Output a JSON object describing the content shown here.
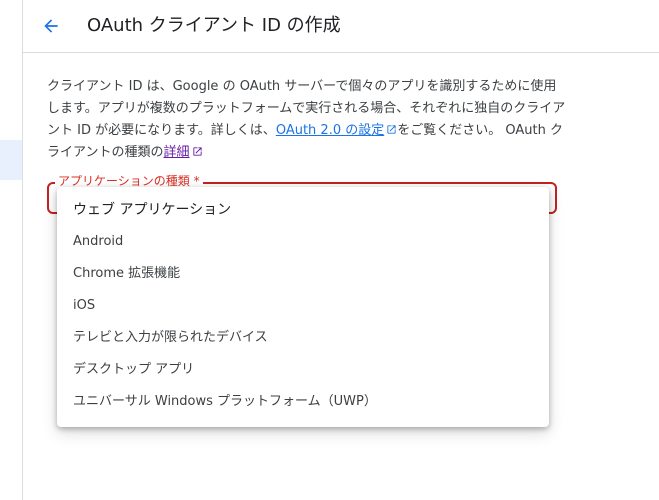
{
  "header": {
    "title": "OAuth クライアント ID の作成",
    "back_icon": "arrow-back-icon"
  },
  "description": {
    "text_1": "クライアント ID は、Google の OAuth サーバーで個々のアプリを識別するために使用します。アプリが複数のプラットフォームで実行される場合、それぞれに独自のクライアント ID が必要になります。詳しくは、",
    "link_oauth": "OAuth 2.0 の設定",
    "text_2": "をご覧ください。 OAuth クライアントの種類の",
    "link_more": "詳細"
  },
  "field": {
    "label": "アプリケーションの種類 *",
    "error_color": "#c5221f"
  },
  "dropdown": {
    "options": [
      "ウェブ アプリケーション",
      "Android",
      "Chrome 拡張機能",
      "iOS",
      "テレビと入力が限られたデバイス",
      "デスクトップ アプリ",
      "ユニバーサル Windows プラットフォーム（UWP）"
    ]
  },
  "colors": {
    "link": "#1a73e8",
    "visited_link": "#681da8",
    "accent": "#1a73e8"
  }
}
